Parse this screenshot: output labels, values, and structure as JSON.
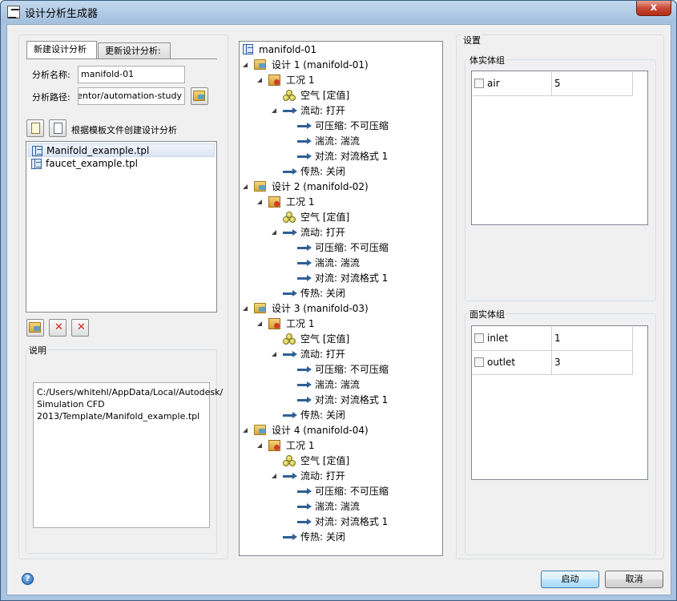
{
  "window": {
    "title": "设计分析生成器",
    "close_glyph": "x"
  },
  "left": {
    "tabs": [
      {
        "label": "新建设计分析",
        "active": true
      },
      {
        "label": "更新设计分析:",
        "active": false
      }
    ],
    "name_label": "分析名称:",
    "name_value": "manifold-01",
    "path_label": "分析路径:",
    "path_value": "Inventor/automation-study",
    "template_label": "根据模板文件创建设计分析",
    "templates": [
      {
        "name": "Manifold_example.tpl",
        "selected": true
      },
      {
        "name": "faucet_example.tpl",
        "selected": false
      }
    ],
    "description_title": "说明",
    "description_text": "C:/Users/whitehl/AppData/Local/Autodesk/ Simulation CFD 2013/Template/Manifold_example.tpl"
  },
  "tree": {
    "root": "manifold-01",
    "designs": [
      {
        "label": "设计 1 (manifold-01)",
        "scenario": "工况 1",
        "material": "空气 [定值]",
        "flow": "流动: 打开",
        "compress": "可压缩: 不可压缩",
        "turb": "湍流: 湍流",
        "adv": "对流: 对流格式 1",
        "heat": "传热: 关闭"
      },
      {
        "label": "设计 2 (manifold-02)",
        "scenario": "工况 1",
        "material": "空气 [定值]",
        "flow": "流动: 打开",
        "compress": "可压缩: 不可压缩",
        "turb": "湍流: 湍流",
        "adv": "对流: 对流格式 1",
        "heat": "传热: 关闭"
      },
      {
        "label": "设计 3 (manifold-03)",
        "scenario": "工况 1",
        "material": "空气 [定值]",
        "flow": "流动: 打开",
        "compress": "可压缩: 不可压缩",
        "turb": "湍流: 湍流",
        "adv": "对流: 对流格式 1",
        "heat": "传热: 关闭"
      },
      {
        "label": "设计 4 (manifold-04)",
        "scenario": "工况 1",
        "material": "空气 [定值]",
        "flow": "流动: 打开",
        "compress": "可压缩: 不可压缩",
        "turb": "湍流: 湍流",
        "adv": "对流: 对流格式 1",
        "heat": "传热: 关闭"
      }
    ]
  },
  "settings": {
    "title": "设置",
    "volume_group_title": "体实体组",
    "volume_rows": [
      {
        "name": "air",
        "value": "5"
      }
    ],
    "surface_group_title": "面实体组",
    "surface_rows": [
      {
        "name": "inlet",
        "value": "1"
      },
      {
        "name": "outlet",
        "value": "3"
      }
    ]
  },
  "footer": {
    "help_glyph": "?",
    "start_label": "启动",
    "cancel_label": "取消"
  }
}
